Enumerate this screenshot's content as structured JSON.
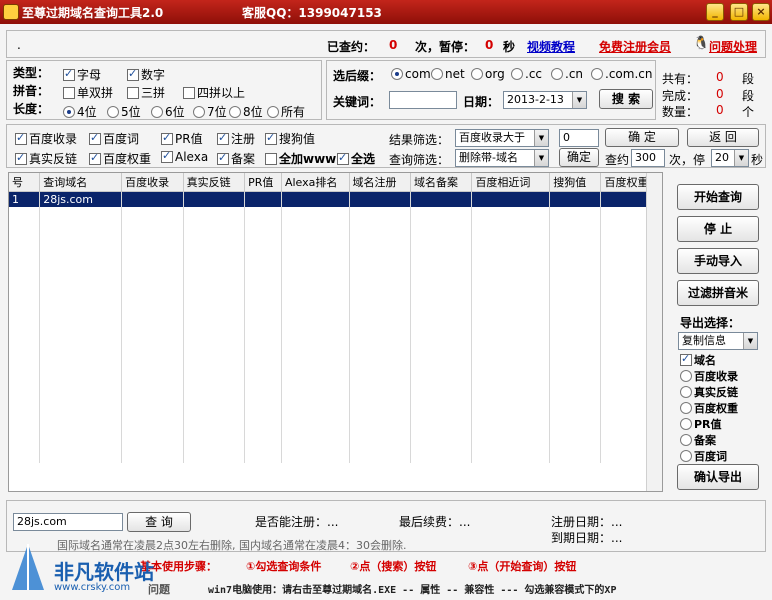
{
  "window": {
    "title": "至尊过期域名查询工具2.0",
    "qq_label": "客服QQ：1399047153"
  },
  "status": {
    "checked_label": "已查约：",
    "checked_value": "0",
    "pause_label": "次，暂停：",
    "pause_value": "0",
    "seconds_label": "秒",
    "video_link": "视频教程",
    "register_link": "免费注册会员",
    "problem_link": "问题处理"
  },
  "types": {
    "type_label": "类型：",
    "pinyin_label": "拼音：",
    "length_label": "长度：",
    "type_options": [
      {
        "label": "字母",
        "checked": true
      },
      {
        "label": "数字",
        "checked": true
      }
    ],
    "pinyin_options": [
      {
        "label": "单双拼",
        "checked": false
      },
      {
        "label": "三拼",
        "checked": false
      },
      {
        "label": "四拼以上",
        "checked": false
      }
    ],
    "length_options": [
      {
        "label": "4位",
        "selected": true
      },
      {
        "label": "5位",
        "selected": false
      },
      {
        "label": "6位",
        "selected": false
      },
      {
        "label": "7位",
        "selected": false
      },
      {
        "label": "8位",
        "selected": false
      },
      {
        "label": "所有",
        "selected": false
      }
    ]
  },
  "search": {
    "suffix_label": "选后缀：",
    "suffixes": [
      {
        "label": "com",
        "selected": true
      },
      {
        "label": "net",
        "selected": false
      },
      {
        "label": "org",
        "selected": false
      },
      {
        "label": ".cc",
        "selected": false
      },
      {
        "label": ".cn",
        "selected": false
      },
      {
        "label": ".com.cn",
        "selected": false
      }
    ],
    "keyword_label": "关键词：",
    "keyword_value": "",
    "date_label": "日期：",
    "date_value": "2013-2-13",
    "search_button": "搜 索"
  },
  "stats": {
    "total_label": "共有：",
    "total_value": "0",
    "done_label": "完成：",
    "done_value": "0",
    "count_label": "数量：",
    "count_value": "0",
    "unit_segments": "段",
    "unit_items": "个"
  },
  "filters": {
    "row1": [
      {
        "label": "百度收录",
        "checked": true
      },
      {
        "label": "百度词",
        "checked": true
      },
      {
        "label": "PR值",
        "checked": true
      },
      {
        "label": "注册",
        "checked": true
      },
      {
        "label": "搜狗值",
        "checked": true
      }
    ],
    "row2": [
      {
        "label": "真实反链",
        "checked": true
      },
      {
        "label": "百度权重",
        "checked": true
      },
      {
        "label": "Alexa",
        "checked": true
      },
      {
        "label": "备案",
        "checked": true
      },
      {
        "label": "全加www",
        "checked": false
      },
      {
        "label": "全选",
        "checked": true
      }
    ],
    "result_filter_label": "结果筛选：",
    "result_filter_value": "百度收录大于",
    "result_filter_number": "0",
    "confirm_button": "确 定",
    "back_button": "返 回",
    "query_filter_label": "查询筛选：",
    "query_filter_value": "删除带-域名",
    "confirm2_button": "确定",
    "query_about_label": "查约",
    "query_count": "300",
    "times_stop_label": "次，停",
    "stop_value": "20",
    "seconds_label": "秒"
  },
  "table": {
    "columns": [
      "号",
      "查询域名",
      "百度收录",
      "真实反链",
      "PR值",
      "Alexa排名",
      "域名注册",
      "域名备案",
      "百度相近词",
      "搜狗值",
      "百度权重"
    ],
    "rows": [
      [
        "1",
        "28js.com",
        "",
        "",
        "",
        "",
        "",
        "",
        "",
        "",
        ""
      ]
    ]
  },
  "side": {
    "start_button": "开始查询",
    "stop_button": "停 止",
    "import_button": "手动导入",
    "filter_button": "过滤拼音米",
    "export_label": "导出选择：",
    "export_mode": "复制信息",
    "export_options": [
      {
        "label": "域名",
        "kind": "check",
        "checked": true
      },
      {
        "label": "百度收录",
        "kind": "radio",
        "checked": false
      },
      {
        "label": "真实反链",
        "kind": "radio",
        "checked": false
      },
      {
        "label": "百度权重",
        "kind": "radio",
        "checked": false
      },
      {
        "label": "PR值",
        "kind": "radio",
        "checked": false
      },
      {
        "label": "备案",
        "kind": "radio",
        "checked": false
      },
      {
        "label": "百度词",
        "kind": "radio",
        "checked": false
      }
    ],
    "confirm_export_button": "确认导出"
  },
  "bottom": {
    "domain_input": "28js.com",
    "query_button": "查 询",
    "can_register_label": "是否能注册：...",
    "last_renew_label": "最后续费：...",
    "reg_date_label": "注册日期：...",
    "expire_date_label": "到期日期：...",
    "notice": "国际域名通常在凌晨2点30左右删除, 国内域名通常在凌晨4：30会删除."
  },
  "footer": {
    "steps_label": "基本使用步骤：",
    "step1": "①勾选查询条件",
    "step2": "②点（搜索）按钮",
    "step3": "③点（开始查询）按钮",
    "problems": "问题",
    "win7_note": "win7电脑使用：请右击至尊过期域名.EXE -- 属性 -- 兼容性 --- 勾选兼容模式下的XP"
  },
  "watermark": {
    "site": "非凡软件站",
    "url": "www.crsky.com"
  },
  "colors": {
    "title_bar": "#b51c12",
    "accent_red": "#d40000",
    "link_blue": "#0000c8",
    "selected_row": "#0a246a"
  }
}
